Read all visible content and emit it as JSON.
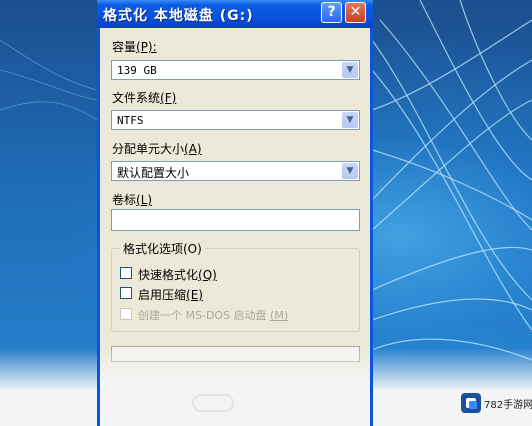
{
  "window": {
    "title": "格式化 本地磁盘 (G:)",
    "help_label": "?",
    "close_label": "✕"
  },
  "capacity": {
    "label_text": "容量",
    "label_hotkey": "(P):",
    "value": "139 GB"
  },
  "filesystem": {
    "label_text": "文件系统",
    "label_hotkey": "(F)",
    "value": "NTFS"
  },
  "allocation": {
    "label_text": "分配单元大小",
    "label_hotkey": "(A)",
    "value": "默认配置大小"
  },
  "volume_label": {
    "label_text": "卷标",
    "label_hotkey": "(L)",
    "value": ""
  },
  "format_options": {
    "title": "格式化选项(O)",
    "quick_format": {
      "label": "快速格式化",
      "hotkey": "(Q)",
      "checked": false
    },
    "enable_compression": {
      "label": "启用压缩",
      "hotkey": "(E)",
      "checked": false
    },
    "ms_dos_startup": {
      "label": "创建一个 MS-DOS 启动盘",
      "hotkey": "(M)",
      "checked": false,
      "enabled": false
    }
  },
  "colors": {
    "titlebar": "#0a52dc",
    "dialog_bg": "#ece9d8",
    "desktop": "#1f6db8",
    "close": "#c5421f"
  },
  "watermark": {
    "text": "782手游网",
    "icon": "site-logo-icon"
  }
}
